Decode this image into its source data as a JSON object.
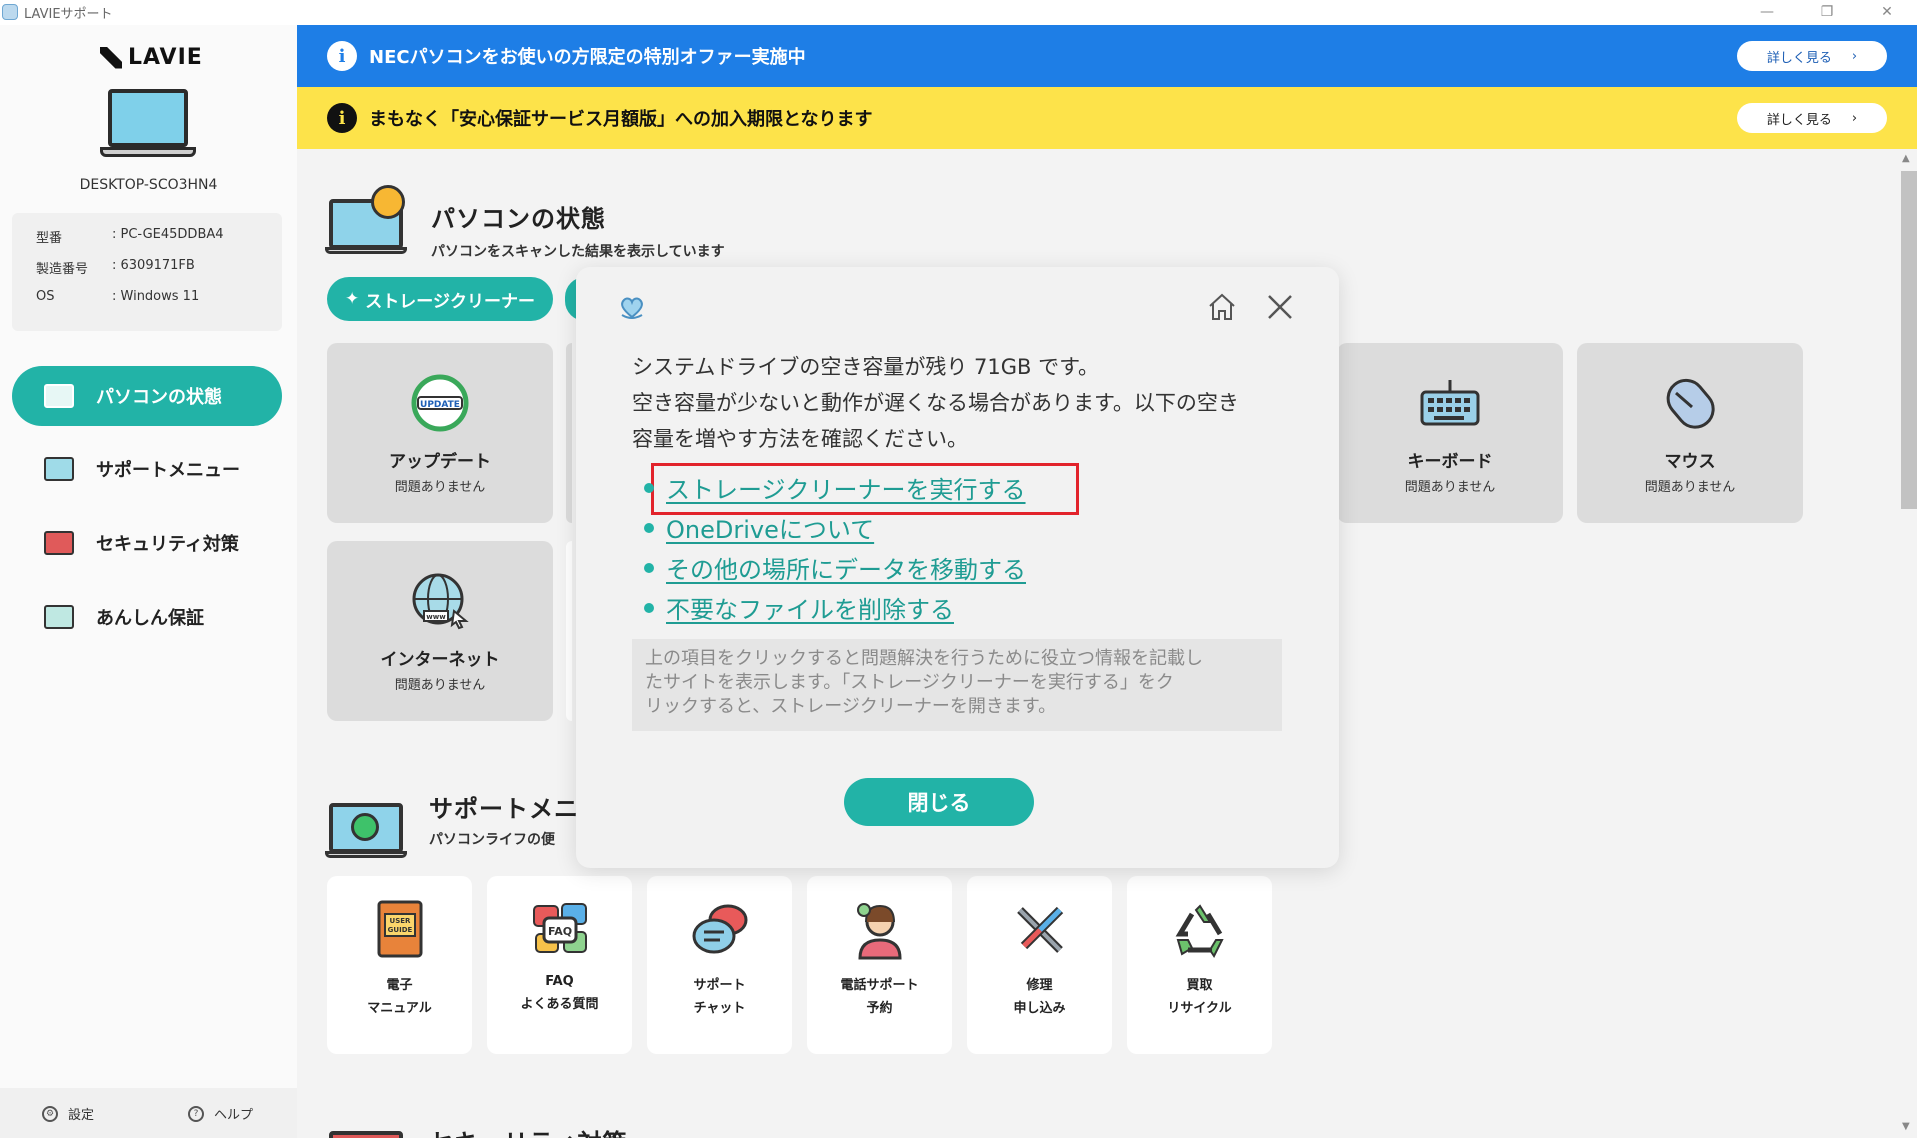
{
  "window": {
    "title": "LAVIEサポート",
    "controls": {
      "minimize": "—",
      "restore": "❐",
      "close": "✕"
    }
  },
  "sidebar": {
    "brand": "LAVIE",
    "hostname": "DESKTOP-SCO3HN4",
    "specs": [
      {
        "key": "型番",
        "value": ": PC-GE45DDBA4"
      },
      {
        "key": "製造番号",
        "value": ": 6309171FB"
      },
      {
        "key": "OS",
        "value": ": Windows 11"
      }
    ],
    "nav": [
      {
        "label": "パソコンの状態",
        "active": true,
        "icon": "pc-status-icon"
      },
      {
        "label": "サポートメニュー",
        "active": false,
        "icon": "support-menu-icon"
      },
      {
        "label": "セキュリティ対策",
        "active": false,
        "icon": "security-icon"
      },
      {
        "label": "あんしん保証",
        "active": false,
        "icon": "warranty-icon"
      }
    ],
    "footer": {
      "settings": "設定",
      "help": "ヘルプ"
    }
  },
  "banners": {
    "offer": {
      "text": "NECパソコンをお使いの方限定の特別オファー実施中",
      "more": "詳しく見る",
      "color": "#1e7ee6"
    },
    "notice": {
      "text": "まもなく「安心保証サービス月額版」への加入期限となります",
      "more": "詳しく見る",
      "color": "#fde34a"
    }
  },
  "status_section": {
    "title": "パソコンの状態",
    "subtitle": "パソコンをスキャンした結果を表示しています",
    "storage_button": "ストレージクリーナー",
    "cards": [
      {
        "name": "アップデート",
        "status": "問題ありません",
        "icon": "update-icon"
      },
      {
        "name": "キーボード",
        "status": "問題ありません",
        "icon": "keyboard-icon"
      },
      {
        "name": "マウス",
        "status": "問題ありません",
        "icon": "mouse-icon"
      },
      {
        "name": "インターネット",
        "status": "問題ありません",
        "icon": "globe-icon"
      }
    ]
  },
  "support_section": {
    "title": "サポートメニ",
    "subtitle": "パソコンライフの便",
    "items": [
      {
        "line1": "電子",
        "line2": "マニュアル",
        "icon": "user-guide-icon"
      },
      {
        "line1": "FAQ",
        "line2": "よくある質問",
        "icon": "faq-icon"
      },
      {
        "line1": "サポート",
        "line2": "チャット",
        "icon": "chat-icon"
      },
      {
        "line1": "電話サポート",
        "line2": "予約",
        "icon": "phone-support-icon"
      },
      {
        "line1": "修理",
        "line2": "申し込み",
        "icon": "repair-icon"
      },
      {
        "line1": "買取",
        "line2": "リサイクル",
        "icon": "recycle-icon"
      }
    ]
  },
  "next_section": {
    "title": "セキュリティ対策"
  },
  "modal": {
    "message_lines": [
      "システムドライブの空き容量が残り 71GB です。",
      "空き容量が少ないと動作が遅くなる場合があります。以下の空き",
      "容量を増やす方法を確認ください。"
    ],
    "links": [
      "ストレージクリーナーを実行する",
      "OneDriveについて",
      "その他の場所にデータを移動する",
      "不要なファイルを削除する"
    ],
    "note_lines": [
      "上の項目をクリックすると問題解決を行うために役立つ情報を記載し",
      "たサイトを表示します。「ストレージクリーナーを実行する」をク",
      "リックすると、ストレージクリーナーを開きます。"
    ],
    "close_button": "閉じる"
  },
  "colors": {
    "accent": "#22b3a7",
    "highlight": "#e2232b",
    "link": "#1f9c93"
  }
}
